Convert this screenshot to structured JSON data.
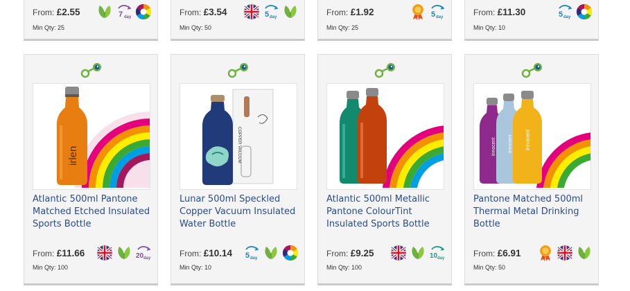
{
  "top_cards": [
    {
      "price_label": "From:",
      "price": "£2.55",
      "min_qty": "Min Qty: 25",
      "badges": [
        "eco-leaf-icon",
        "7-day-icon",
        "colour-wheel-icon"
      ],
      "day_text": "7",
      "day_word": "day"
    },
    {
      "price_label": "From:",
      "price": "£3.54",
      "min_qty": "Min Qty: 50",
      "badges": [
        "uk-flag-icon",
        "5-day-icon",
        "eco-leaf-icon"
      ],
      "day_text": "5",
      "day_word": "day"
    },
    {
      "price_label": "From:",
      "price": "£1.92",
      "min_qty": "Min Qty: 25",
      "badges": [
        "award-medal-icon",
        "5-day-icon"
      ],
      "day_text": "5",
      "day_word": "day"
    },
    {
      "price_label": "From:",
      "price": "£11.30",
      "min_qty": "Min Qty: 10",
      "badges": [
        "5-day-icon",
        "colour-wheel-icon"
      ],
      "day_text": "5",
      "day_word": "day"
    }
  ],
  "products": [
    {
      "title": "Atlantic 500ml Pantone Matched Etched Insulated Sports Bottle",
      "price_label": "From:",
      "price": "£11.66",
      "min_qty": "Min Qty: 100",
      "day_text": "20",
      "day_word": "day"
    },
    {
      "title": "Lunar 500ml Speckled Copper Vacuum Insulated Water Bottle",
      "price_label": "From:",
      "price": "£10.14",
      "min_qty": "Min Qty: 10",
      "day_text": "5",
      "day_word": "day"
    },
    {
      "title": "Atlantic 500ml Metallic Pantone ColourTint Insulated Sports Bottle",
      "price_label": "From:",
      "price": "£9.25",
      "min_qty": "Min Qty: 100",
      "day_text": "10",
      "day_word": "day"
    },
    {
      "title": "Pantone Matched 500ml Thermal Metal Drinking Bottle",
      "price_label": "From:",
      "price": "£6.91",
      "min_qty": "Min Qty: 50",
      "day_text": "",
      "day_word": ""
    }
  ],
  "product_labels": {
    "irlen": "irlen",
    "box_text": "COPPER VACUUM",
    "innocent": "innocent"
  },
  "colors": {
    "title_blue": "#2a4b8d",
    "leaf_green": "#6db33f",
    "day_purple": "#7d4fa0",
    "day_blue": "#1a82c4",
    "day_teal": "#1a9a8a",
    "compare_green": "#6db33f"
  }
}
